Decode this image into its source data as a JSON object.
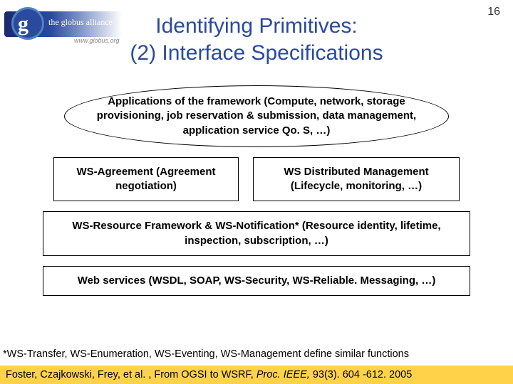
{
  "page_number": "16",
  "logo": {
    "glyph": "g",
    "text": "the globus alliance",
    "subtext": "www.globus.org"
  },
  "title_line1": "Identifying Primitives:",
  "title_line2": "(2) Interface Specifications",
  "ellipse": "Applications of the framework (Compute, network, storage provisioning, job reservation & submission, data management, application service Qo. S, …)",
  "box_left": "WS-Agreement (Agreement negotiation)",
  "box_right": "WS Distributed Management (Lifecycle, monitoring, …)",
  "box_wsrf": "WS-Resource Framework & WS-Notification* (Resource identity, lifetime, inspection, subscription, …)",
  "box_ws": "Web services (WSDL, SOAP, WS-Security, WS-Reliable. Messaging, …)",
  "footnote": "*WS-Transfer, WS-Enumeration, WS-Eventing, WS-Management define similar functions",
  "citation_prefix": "Foster, Czajkowski, Frey, et al. , From OGSI to WSRF, ",
  "citation_journal": "Proc. IEEE, ",
  "citation_suffix": "93(3). 604 -612. 2005"
}
